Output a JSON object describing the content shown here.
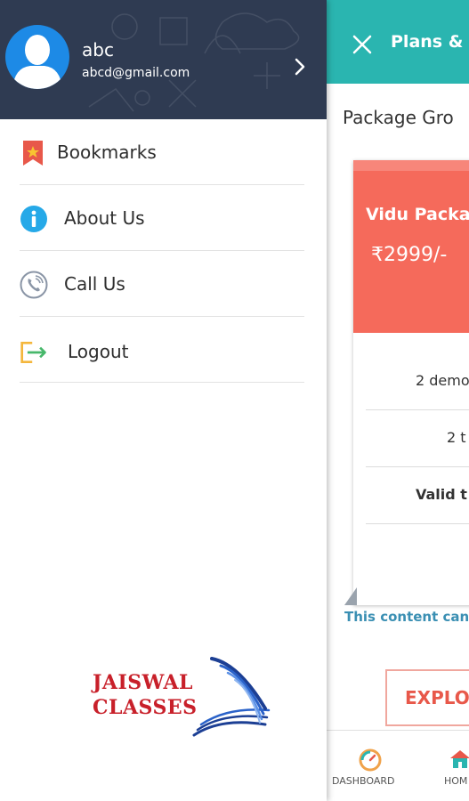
{
  "drawer": {
    "user": {
      "name": "abc",
      "email": "abcd@gmail.com"
    },
    "menu": [
      {
        "label": "Bookmarks",
        "icon": "bookmark-icon"
      },
      {
        "label": "About Us",
        "icon": "info-icon"
      },
      {
        "label": "Call Us",
        "icon": "phone-icon"
      },
      {
        "label": "Logout",
        "icon": "logout-icon"
      }
    ],
    "logo": {
      "line1": "JAISWAL",
      "line2": "CLASSES"
    }
  },
  "app": {
    "header_title": "Plans & F",
    "section_title": "Package Gro",
    "card": {
      "name": "Vidu Packag",
      "price": "₹2999/-",
      "features": [
        "2 demo",
        "2 t",
        "Valid t"
      ]
    },
    "content_note": "This content can",
    "explore_label": "EXPLOR",
    "bottom_nav": [
      {
        "label": "DASHBOARD",
        "icon": "dashboard-icon"
      },
      {
        "label": "HOM",
        "icon": "home-icon"
      }
    ]
  },
  "colors": {
    "header_teal": "#2ab5b0",
    "drawer_header": "#2f3b52",
    "card_accent": "#f56a5b",
    "avatar_blue": "#1d8ae6",
    "brand_red": "#c8202a"
  }
}
